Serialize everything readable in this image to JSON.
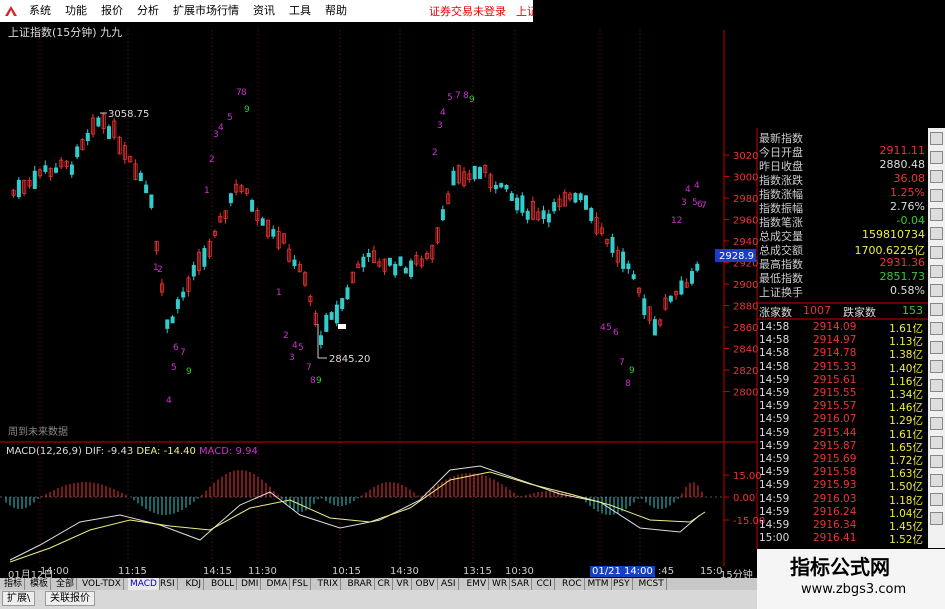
{
  "menubar": {
    "items": [
      "系统",
      "功能",
      "报价",
      "分析",
      "扩展市场行情",
      "资讯",
      "工具",
      "帮助"
    ],
    "right_items": [
      "证券交易未登录",
      "上证指"
    ]
  },
  "chart": {
    "title": "上证指数(15分钟) 九九",
    "note": "周到未来数据",
    "high_label": "3058.75",
    "low_label": "2845.20",
    "last_price_tag": "2928.9",
    "timeframe": "15分钟"
  },
  "price_axis": [
    "3020",
    "3000",
    "2980",
    "2960",
    "2940",
    "2920",
    "2900",
    "2880",
    "2860",
    "2840",
    "2820",
    "2800"
  ],
  "macd": {
    "label": "MACD(12,26,9)",
    "dif": "DIF: -9.43",
    "dea": "DEA: -14.40",
    "macd": "MACD: 9.94",
    "axis": [
      "15.00",
      "0.00",
      "-15.00"
    ]
  },
  "quote": [
    {
      "label": "最新指数",
      "value": "",
      "color": "#e33"
    },
    {
      "label": "今日开盘",
      "value": "2911.11",
      "color": "#e33"
    },
    {
      "label": "昨日收盘",
      "value": "2880.48",
      "color": "#ddd"
    },
    {
      "label": "指数涨跌",
      "value": "36.08",
      "color": "#e33"
    },
    {
      "label": "指数涨幅",
      "value": "1.25%",
      "color": "#e33"
    },
    {
      "label": "指数振幅",
      "value": "2.76%",
      "color": "#ddd"
    },
    {
      "label": "指数笔涨",
      "value": "-0.04",
      "color": "#3c3"
    },
    {
      "label": "总成交量",
      "value": "159810734",
      "color": "#ee4"
    },
    {
      "label": "总成交额",
      "value": "1700.6225亿",
      "color": "#ee4"
    },
    {
      "label": "最高指数",
      "value": "2931.36",
      "color": "#e33"
    },
    {
      "label": "最低指数",
      "value": "2851.73",
      "color": "#3c3"
    },
    {
      "label": "上证换手",
      "value": "0.58%",
      "color": "#ddd"
    }
  ],
  "updown": {
    "up_label": "涨家数",
    "up_value": "1007",
    "down_label": "跌家数",
    "down_value": "153"
  },
  "ticks": [
    {
      "time": "14:58",
      "price": "2914.09",
      "vol": "1.61亿"
    },
    {
      "time": "14:58",
      "price": "2914.97",
      "vol": "1.13亿"
    },
    {
      "time": "14:58",
      "price": "2914.78",
      "vol": "1.38亿"
    },
    {
      "time": "14:58",
      "price": "2915.33",
      "vol": "1.40亿"
    },
    {
      "time": "14:59",
      "price": "2915.61",
      "vol": "1.16亿"
    },
    {
      "time": "14:59",
      "price": "2915.55",
      "vol": "1.34亿"
    },
    {
      "time": "14:59",
      "price": "2915.57",
      "vol": "1.46亿"
    },
    {
      "time": "14:59",
      "price": "2916.07",
      "vol": "1.29亿"
    },
    {
      "time": "14:59",
      "price": "2915.44",
      "vol": "1.61亿"
    },
    {
      "time": "14:59",
      "price": "2915.87",
      "vol": "1.65亿"
    },
    {
      "time": "14:59",
      "price": "2915.69",
      "vol": "1.72亿"
    },
    {
      "time": "14:59",
      "price": "2915.58",
      "vol": "1.63亿"
    },
    {
      "time": "14:59",
      "price": "2915.93",
      "vol": "1.50亿"
    },
    {
      "time": "14:59",
      "price": "2916.03",
      "vol": "1.18亿"
    },
    {
      "time": "14:59",
      "price": "2916.24",
      "vol": "1.04亿"
    },
    {
      "time": "14:59",
      "price": "2916.34",
      "vol": "1.45亿"
    },
    {
      "time": "15:00",
      "price": "2916.41",
      "vol": "1.52亿"
    }
  ],
  "xaxis": [
    "01月12日",
    "14:00",
    "11:15",
    "14:15",
    "11:30",
    "10:15",
    "14:30",
    "13:15",
    "10:30",
    "01/21 14:00",
    ":45",
    "15:0"
  ],
  "tabs": [
    "指标",
    "模板",
    "全部",
    "VOL-TDX",
    "MACD",
    "RSI",
    "KDJ",
    "BOLL",
    "DMI",
    "DMA",
    "FSL",
    "TRIX",
    "BRAR",
    "CR",
    "VR",
    "OBV",
    "ASI",
    "EMV",
    "WR",
    "SAR",
    "CCI",
    "ROC",
    "MTM",
    "PSY",
    "MCST"
  ],
  "bottom_tabs": [
    "扩展\\",
    "关联报价"
  ],
  "watermark": {
    "main": "指标公式网",
    "url": "www.zbgs3.com"
  },
  "colors": {
    "up": "#e33",
    "down": "#3cc",
    "grid": "#7a1010",
    "axis": "#c00",
    "seq": "#c3c"
  }
}
